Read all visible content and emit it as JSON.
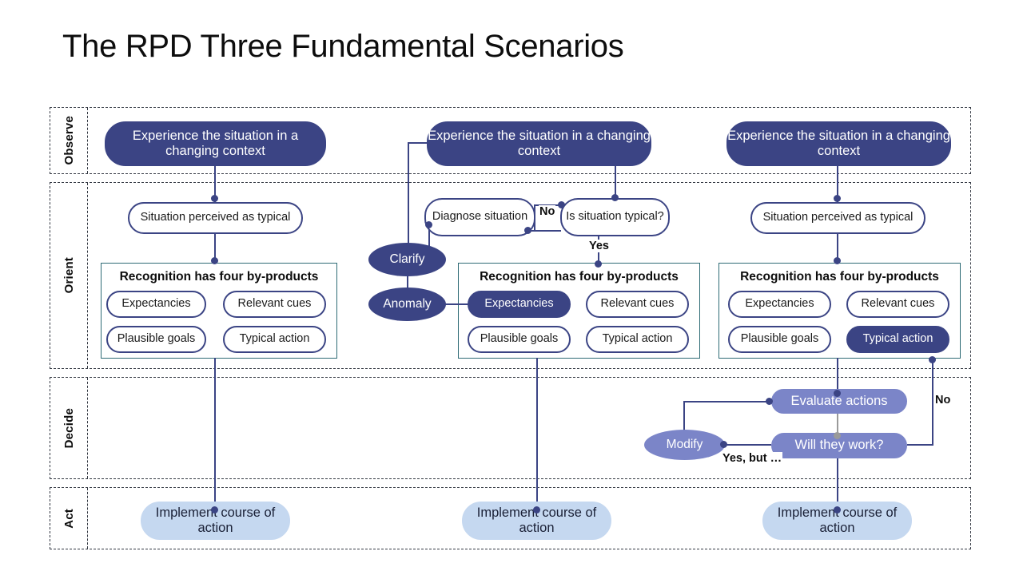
{
  "title": "The RPD Three Fundamental Scenarios",
  "lanes": [
    {
      "id": "observe",
      "label": "Observe"
    },
    {
      "id": "orient",
      "label": "Orient"
    },
    {
      "id": "decide",
      "label": "Decide"
    },
    {
      "id": "act",
      "label": "Act"
    }
  ],
  "colors": {
    "navy": "#3b4484",
    "mid_blue": "#7b85c8",
    "light_blue": "#c5d8f0",
    "group_border": "#2e6b75",
    "lane_border": "#333842",
    "gray_connector": "#9a9a9a"
  },
  "columns": {
    "simple_match": {
      "observe": "Experience the situation in a changing context",
      "situation": "Situation perceived as typical",
      "group_title": "Recognition has four by-products",
      "byproducts": [
        {
          "label": "Expectancies",
          "highlight": false
        },
        {
          "label": "Relevant cues",
          "highlight": false
        },
        {
          "label": "Plausible goals",
          "highlight": false
        },
        {
          "label": "Typical action",
          "highlight": false
        }
      ],
      "act": "Implement course of action"
    },
    "diagnose": {
      "observe": "Experience the situation in a changing context",
      "diagnose": "Diagnose situation",
      "decision": "Is situation typical?",
      "edge_no": "No",
      "edge_yes": "Yes",
      "clarify": "Clarify",
      "anomaly": "Anomaly",
      "group_title": "Recognition has four by-products",
      "byproducts": [
        {
          "label": "Expectancies",
          "highlight": true
        },
        {
          "label": "Relevant cues",
          "highlight": false
        },
        {
          "label": "Plausible goals",
          "highlight": false
        },
        {
          "label": "Typical action",
          "highlight": false
        }
      ],
      "act": "Implement course of action"
    },
    "evaluate": {
      "observe": "Experience the situation in a changing context",
      "situation": "Situation perceived as typical",
      "group_title": "Recognition has four by-products",
      "byproducts": [
        {
          "label": "Expectancies",
          "highlight": false
        },
        {
          "label": "Relevant cues",
          "highlight": false
        },
        {
          "label": "Plausible goals",
          "highlight": false
        },
        {
          "label": "Typical action",
          "highlight": true
        }
      ],
      "evaluate": "Evaluate actions",
      "will_work": "Will they work?",
      "modify": "Modify",
      "edge_no": "No",
      "edge_yes_but": "Yes, but …",
      "act": "Implement course of action"
    }
  }
}
